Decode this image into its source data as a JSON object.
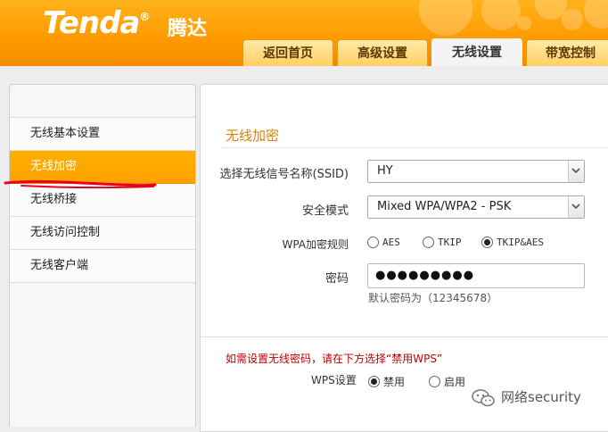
{
  "header": {
    "logo_text": "Tenda",
    "logo_reg": "®",
    "logo_cn": "腾达",
    "tabs": [
      {
        "label": "返回首页"
      },
      {
        "label": "高级设置"
      },
      {
        "label": "无线设置"
      },
      {
        "label": "带宽控制"
      }
    ],
    "active_tab": "无线设置"
  },
  "sidebar": {
    "items": [
      {
        "label": "无线基本设置"
      },
      {
        "label": "无线加密"
      },
      {
        "label": "无线桥接"
      },
      {
        "label": "无线访问控制"
      },
      {
        "label": "无线客户端"
      }
    ],
    "active_item": "无线加密",
    "annotation_color": "#e8001c"
  },
  "main": {
    "section_title": "无线加密",
    "ssid": {
      "label": "选择无线信号名称(SSID)",
      "value": "HY"
    },
    "security_mode": {
      "label": "安全模式",
      "value": "Mixed WPA/WPA2 - PSK"
    },
    "wpa_rule": {
      "label": "WPA加密规则",
      "options": [
        {
          "label": "AES",
          "selected": false
        },
        {
          "label": "TKIP",
          "selected": false
        },
        {
          "label": "TKIP&AES",
          "selected": true
        }
      ]
    },
    "password": {
      "label": "密码",
      "value": "●●●●●●●●●"
    },
    "default_hint": "默认密码为（12345678）",
    "notice": "如需设置无线密码，请在下方选择“禁用WPS”",
    "wps": {
      "label": "WPS设置",
      "options": [
        {
          "label": "禁用",
          "selected": true
        },
        {
          "label": "启用",
          "selected": false
        }
      ]
    }
  },
  "watermark": {
    "text": "网络security"
  },
  "colors": {
    "brand_orange": "#ff9a00",
    "accent_title": "#e08000",
    "notice_red": "#c00000"
  }
}
